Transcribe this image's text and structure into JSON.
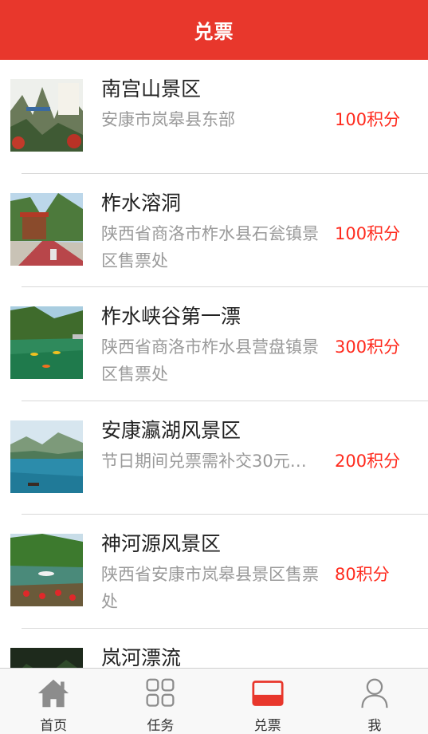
{
  "header": {
    "title": "兑票"
  },
  "items": [
    {
      "title": "南宫山景区",
      "desc": "安康市岚皋县东部",
      "points": "100积分"
    },
    {
      "title": "柞水溶洞",
      "desc": "陕西省商洛市柞水县石瓮镇景区售票处",
      "points": "100积分"
    },
    {
      "title": "柞水峡谷第一漂",
      "desc": "陕西省商洛市柞水县营盘镇景区售票处",
      "points": "300积分"
    },
    {
      "title": "安康瀛湖风景区",
      "desc": "节日期间兑票需补交30元…",
      "points": "200积分"
    },
    {
      "title": "神河源风景区",
      "desc": "陕西省安康市岚皋县景区售票处",
      "points": "80积分"
    },
    {
      "title": "岚河漂流",
      "desc": "",
      "points": ""
    }
  ],
  "tabbar": {
    "tabs": [
      {
        "label": "首页",
        "icon": "home-icon"
      },
      {
        "label": "任务",
        "icon": "grid-icon"
      },
      {
        "label": "兑票",
        "icon": "ticket-icon",
        "active": true,
        "active_color": "#e8372c"
      },
      {
        "label": "我",
        "icon": "user-icon"
      }
    ]
  },
  "colors": {
    "accent": "#e8372c",
    "points": "#ff2a1d",
    "subtext": "#9a9a9a"
  }
}
